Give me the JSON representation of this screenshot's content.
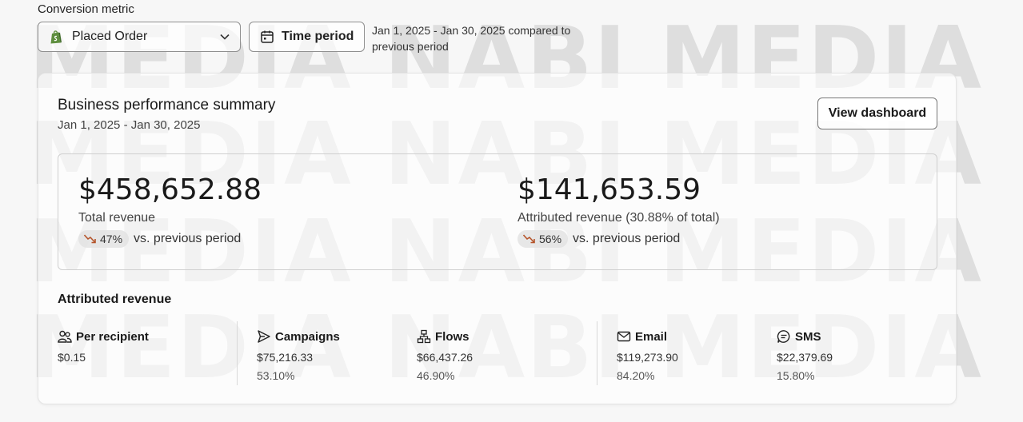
{
  "watermark": {
    "lines": [
      "MEDIA NABI MEDIA",
      "MEDIA NABI MEDIA",
      "MEDIA NABI MEDIA",
      "MEDIA NABI MEDIA"
    ]
  },
  "conversion_metric": {
    "label": "Conversion metric",
    "selected": "Placed Order",
    "icon": "shopify-icon"
  },
  "time_period": {
    "button_label": "Time period",
    "range_text": "Jan 1, 2025 - Jan 30, 2025 compared to previous period"
  },
  "summary": {
    "title": "Business performance summary",
    "date_range": "Jan 1, 2025 - Jan 30, 2025",
    "view_button": "View dashboard",
    "total": {
      "value": "$458,652.88",
      "caption": "Total revenue",
      "change": "47%",
      "change_suffix": "vs. previous period",
      "trend": "down"
    },
    "attributed": {
      "value": "$141,653.59",
      "caption": "Attributed revenue (30.88% of total)",
      "change": "56%",
      "change_suffix": "vs. previous period",
      "trend": "down"
    }
  },
  "attributed_revenue": {
    "title": "Attributed revenue",
    "items": [
      {
        "label": "Per recipient",
        "value": "$0.15",
        "percent": "",
        "icon": "people-icon"
      },
      {
        "label": "Campaigns",
        "value": "$75,216.33",
        "percent": "53.10%",
        "icon": "send-icon"
      },
      {
        "label": "Flows",
        "value": "$66,437.26",
        "percent": "46.90%",
        "icon": "flow-icon"
      },
      {
        "label": "Email",
        "value": "$119,273.90",
        "percent": "84.20%",
        "icon": "email-icon"
      },
      {
        "label": "SMS",
        "value": "$22,379.69",
        "percent": "15.80%",
        "icon": "sms-icon"
      }
    ]
  },
  "colors": {
    "trend_down": "#b5542a",
    "shopify_green": "#5e8e3e"
  }
}
